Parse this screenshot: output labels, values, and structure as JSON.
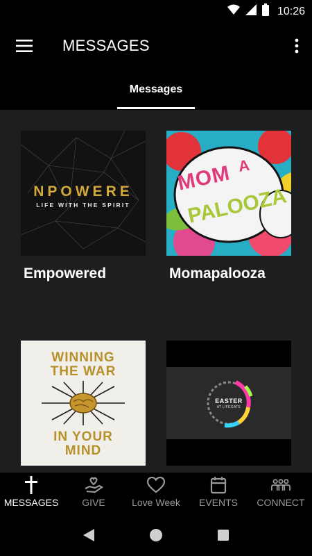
{
  "status_bar": {
    "time": "10:26",
    "icons": [
      "wifi-icon",
      "signal-icon",
      "battery-icon"
    ]
  },
  "app_bar": {
    "title": "MESSAGES",
    "menu_icon": "hamburger-menu-icon",
    "overflow_icon": "more-vertical-icon"
  },
  "tabs": [
    {
      "label": "Messages",
      "selected": true
    }
  ],
  "series": [
    {
      "title": "Empowered",
      "artwork_text": [
        "NPOWERE",
        "LIFE WITH THE SPIRIT"
      ]
    },
    {
      "title": "Momapalooza",
      "artwork_text": [
        "MOM",
        "A",
        "PALOOZA"
      ]
    },
    {
      "title": "",
      "artwork_text": [
        "WINNING",
        "THE WAR",
        "IN YOUR",
        "MIND"
      ]
    },
    {
      "title": "",
      "artwork_text": [
        "EASTER",
        "AT LIFEGATE"
      ]
    }
  ],
  "bottom_nav": [
    {
      "label": "MESSAGES",
      "icon": "cross-icon",
      "active": true
    },
    {
      "label": "GIVE",
      "icon": "give-hand-heart-icon",
      "active": false
    },
    {
      "label": "Love Week",
      "icon": "heart-icon",
      "active": false
    },
    {
      "label": "EVENTS",
      "icon": "calendar-icon",
      "active": false
    },
    {
      "label": "CONNECT",
      "icon": "people-group-icon",
      "active": false
    }
  ],
  "colors": {
    "background": "#000000",
    "content_background": "#1d1e20",
    "active_text": "#ffffff",
    "inactive_text": "#9a9a9a",
    "gold": "#c9a227"
  }
}
